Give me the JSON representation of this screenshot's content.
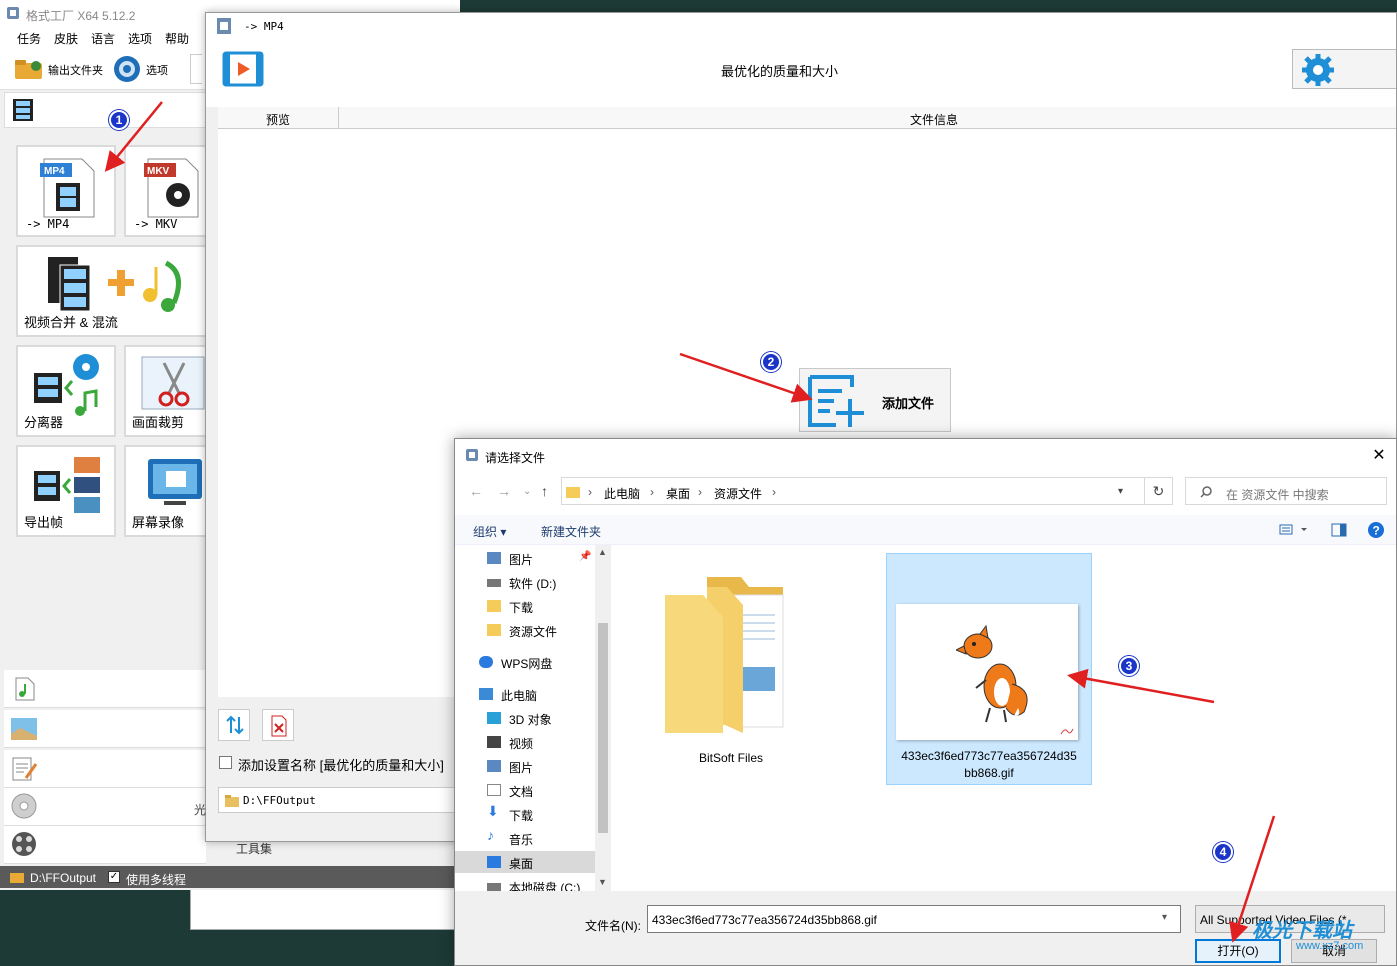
{
  "main_window": {
    "title": "格式工厂 X64 5.12.2",
    "menu": [
      "任务",
      "皮肤",
      "语言",
      "选项",
      "帮助"
    ],
    "toolbar": {
      "output_folder": "输出文件夹",
      "options": "选项"
    },
    "tiles": [
      {
        "label": "-> MP4",
        "badge": "MP4",
        "icon": "mp4-file-icon"
      },
      {
        "label": "-> MKV",
        "badge": "MKV",
        "icon": "mkv-file-icon"
      },
      {
        "label": "视频合并 & 混流",
        "icon": "video-merge-icon"
      },
      {
        "label": "分离器",
        "icon": "demuxer-icon"
      },
      {
        "label": "画面裁剪",
        "icon": "scissors-icon"
      },
      {
        "label": "导出帧",
        "icon": "export-frames-icon"
      },
      {
        "label": "屏幕录像",
        "icon": "screen-record-icon"
      }
    ],
    "status": {
      "path": "D:\\FFOutput",
      "multithread": "使用多线程",
      "multithread_checked": true
    }
  },
  "mp4_dialog": {
    "title": "-> MP4",
    "quality": "最优化的质量和大小",
    "columns": {
      "preview": "预览",
      "file_info": "文件信息"
    },
    "add_file": "添加文件",
    "setting_name": "添加设置名称 [最优化的质量和大小]",
    "output_path": "D:\\FFOutput",
    "toolbox": "工具集",
    "partial_text": "光"
  },
  "open_dialog": {
    "title": "请选择文件",
    "breadcrumb": [
      "此电脑",
      "桌面",
      "资源文件"
    ],
    "search_placeholder": "在 资源文件 中搜索",
    "commands": {
      "organize": "组织 ▾",
      "new_folder": "新建文件夹"
    },
    "nav": [
      {
        "label": "图片",
        "icon": "pictures-icon",
        "pinned": true
      },
      {
        "label": "软件 (D:)",
        "icon": "drive-icon"
      },
      {
        "label": "下载",
        "icon": "folder-icon"
      },
      {
        "label": "资源文件",
        "icon": "folder-icon"
      },
      {
        "label": "WPS网盘",
        "icon": "cloud-icon"
      },
      {
        "label": "此电脑",
        "icon": "computer-icon"
      },
      {
        "label": "3D 对象",
        "icon": "3d-objects-icon"
      },
      {
        "label": "视频",
        "icon": "video-icon"
      },
      {
        "label": "图片",
        "icon": "pictures-icon"
      },
      {
        "label": "文档",
        "icon": "documents-icon"
      },
      {
        "label": "下载",
        "icon": "download-icon"
      },
      {
        "label": "音乐",
        "icon": "music-icon"
      },
      {
        "label": "桌面",
        "icon": "desktop-icon",
        "selected": true
      },
      {
        "label": "本地磁盘 (C:)",
        "icon": "drive-icon"
      }
    ],
    "files": [
      {
        "name": "BitSoft Files",
        "type": "folder"
      },
      {
        "name_line1": "433ec3f6ed773c77ea356724d35",
        "name_line2": "bb868.gif",
        "type": "gif",
        "selected": true
      }
    ],
    "filename_label": "文件名(N):",
    "filename_value": "433ec3f6ed773c77ea356724d35bb868.gif",
    "filter": "All Supported Video Files (*.",
    "open_label": "打开(O)",
    "cancel_label": "取消"
  },
  "annotations": [
    "1",
    "2",
    "3",
    "4"
  ],
  "watermark": {
    "brand": "极光下载站",
    "url": "www.xz7.com"
  },
  "colors": {
    "accent_blue": "#1e8fd6",
    "badge_blue": "#1a35c8",
    "arrow_red": "#e02020",
    "selection": "#cce8ff"
  }
}
